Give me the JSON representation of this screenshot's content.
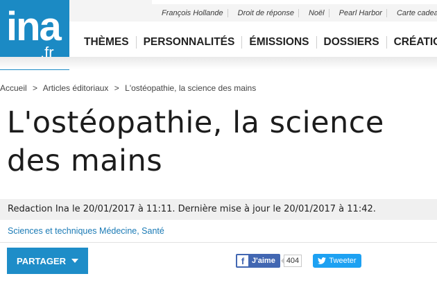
{
  "header": {
    "trend_links": [
      "François Hollande",
      "Droit de réponse",
      "Noël",
      "Pearl Harbor",
      "Carte cadeau"
    ],
    "logo": {
      "main": "ina",
      "sub": ".fr"
    },
    "nav": [
      "THÈMES",
      "PERSONNALITÉS",
      "ÉMISSIONS",
      "DOSSIERS",
      "CRÉATIONS W"
    ]
  },
  "breadcrumb": {
    "items": [
      "Accueil",
      "Articles éditoriaux",
      "L'ostéopathie, la science des mains"
    ],
    "separator": ">"
  },
  "article": {
    "title": "L'ostéopathie, la science des mains",
    "meta": "Redaction Ina le 20/01/2017 à 11:11. Dernière mise à jour le 20/01/2017 à 11:42.",
    "tags": "Sciences et techniques Médecine, Santé"
  },
  "share": {
    "share_label": "PARTAGER",
    "fb_label": "J'aime",
    "fb_count": "404",
    "tweet_label": "Tweeter"
  },
  "colors": {
    "brand": "#1b8ac4",
    "link": "#1a7ab5",
    "facebook": "#4267b2",
    "twitter": "#1da1f2"
  }
}
